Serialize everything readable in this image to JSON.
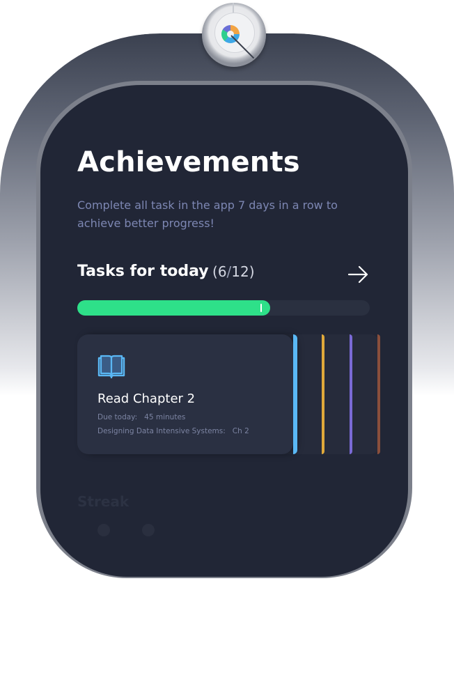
{
  "screen": {
    "title": "Achievements",
    "subtitle": "Complete all task in the app 7 days in a row to achieve better progress!",
    "tasks_header": "Tasks for today",
    "tasks_done": "6",
    "tasks_total": "12",
    "progress": 0.66,
    "progress_color": "#2ee089"
  },
  "cards": {
    "active": {
      "icon": "open-book-icon",
      "title": "Read Chapter 2",
      "due_label": "Due today:",
      "due_value": "45 minutes",
      "book_label": "Designing Data Intensive Systems:",
      "book_value": "Ch 2",
      "accent": "#5ab8f5"
    },
    "stacked_accents": [
      "#e0a93a",
      "#7a6ad6",
      "#8a4f3c"
    ]
  },
  "streak": {
    "title": "Streak"
  },
  "crown": {
    "icon": "pie-chart-icon",
    "colors": [
      "#f2a444",
      "#3fa8e6",
      "#2ecf8e",
      "#6a6fd6"
    ]
  }
}
